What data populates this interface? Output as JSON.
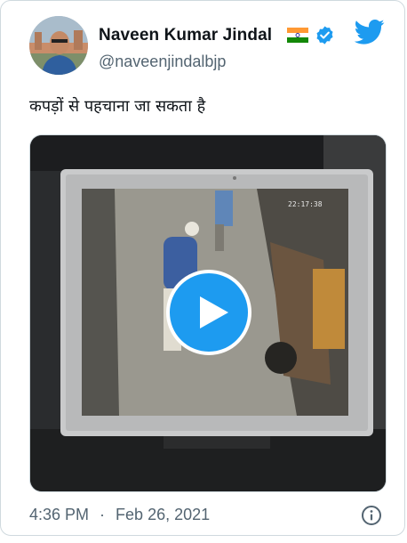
{
  "author": {
    "display_name": "Naveen Kumar Jindal",
    "handle": "@naveenjindalbjp",
    "flag_icon": "india-flag-icon",
    "verified_icon": "verified-badge-icon"
  },
  "brand": {
    "logo_icon": "twitter-bird-icon",
    "accent": "#1d9bf0"
  },
  "tweet": {
    "text": "कपड़ों से पहचाना जा सकता है"
  },
  "media": {
    "type": "video",
    "play_icon": "play-icon",
    "overlay_timestamp": "22:17:38"
  },
  "meta": {
    "time": "4:36 PM",
    "separator": "·",
    "date": "Feb 26, 2021",
    "info_icon": "info-icon"
  }
}
